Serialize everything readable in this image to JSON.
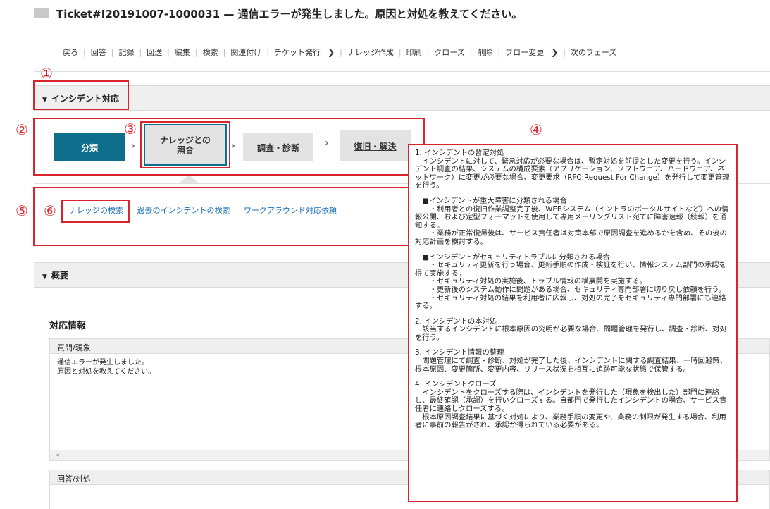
{
  "title": "Ticket#I20191007-1000031 — 通信エラーが発生しました。原因と対処を教えてください。",
  "toolbar": {
    "items": [
      "戻る",
      "回答",
      "記録",
      "回送",
      "編集",
      "検索",
      "関連付け",
      "チケット発行",
      "ナレッジ作成",
      "印刷",
      "クローズ",
      "削除",
      "フロー変更",
      "次のフェーズ"
    ]
  },
  "incident_section": "インシデント対応",
  "steps": [
    "分類",
    "ナレッジとの照合",
    "調査・診断",
    "復旧・解決"
  ],
  "links": [
    "ナレッジの検索",
    "過去のインシデントの検索",
    "ワークアラウンド対応依頼"
  ],
  "overview_section": "概要",
  "info_heading": "対応情報",
  "question_label": "質問/現象",
  "question_lines": [
    "通信エラーが発生しました。",
    "原因と対処を教えてください。"
  ],
  "answer_label": "回答/対処",
  "scroll_left": "◂",
  "markers": [
    "①",
    "②",
    "③",
    "④",
    "⑤",
    "⑥"
  ],
  "callout": [
    "1. インシデントの暫定対処",
    "　インシデントに対して、緊急対応が必要な場合は、暫定対処を前提とした変更を行う。インシデント調査の結果、システムの構成要素（アプリケーション、ソフトウェア、ハードウェア、ネットワーク）に変更が必要な場合、変更要求（RFC:Request For Change）を発行して変更管理を行う。",
    "",
    "　■インシデントが重大障害に分類される場合",
    "　　・利用者との復旧作業調整完了後、WEBシステム（イントラのポータルサイトなど）への情報公開、および定型フォーマットを使用して専用メーリングリスト宛てに障害速報（続報）を通知する。",
    "　　・業務が正常復帰後は、サービス責任者は対策本部で原因調査を進めるかを含め、その後の対応計画を検討する。",
    "",
    "　■インシデントがセキュリティトラブルに分類される場合",
    "　　・セキュリティ更新を行う場合、更新手順の作成・検証を行い、情報システム部門の承認を得て実施する。",
    "　　・セキュリティ対処の実施後、トラブル情報の横展開を実施する。",
    "　　・更新後のシステム動作に問題がある場合、セキュリティ専門部署に切り戻し依頼を行う。",
    "　　・セキュリティ対処の結果を利用者に広報し、対処の完了をセキュリティ専門部署にも連絡する。",
    "",
    "2. インシデントの本対処",
    "　該当するインシデントに根本原因の究明が必要な場合、問題管理を発行し、調査・診断、対処を行う。",
    "",
    "3. インシデント情報の整理",
    "　問題管理にて調査・診断、対処が完了した後、インシデントに関する調査結果、一時回避策、根本原因、変更箇所、変更内容、リリース状況を相互に追跡可能な状態で保管する。",
    "",
    "4. インシデントクローズ",
    "　インシデントをクローズする際は、インシデントを発行した（現象を検出した）部門に連絡し、最終確認（承認）を行いクローズする。自部門で発行したインシデントの場合、サービス責任者に連絡しクローズする。",
    "　根本原因調査結果に基づく対処により、業務手順の変更や、業務の制限が発生する場合、利用者に事前の報告がされ、承認が得られている必要がある。"
  ],
  "colors": {
    "primary": "#0f6e8c",
    "annotation_red": "#d9232d",
    "link": "#1a6fb5"
  }
}
